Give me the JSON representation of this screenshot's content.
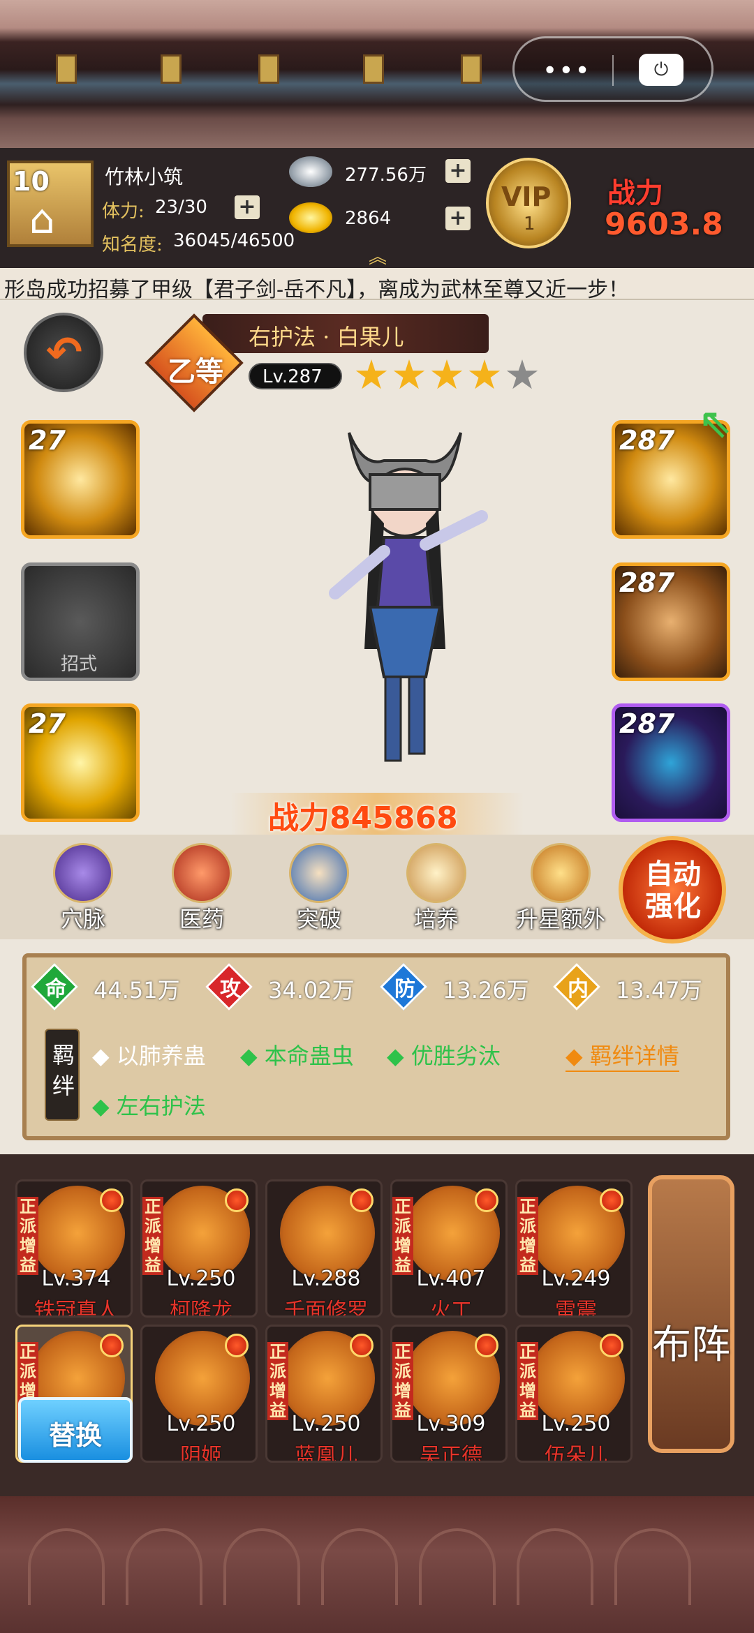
{
  "player": {
    "level": "10",
    "name": "竹林小筑",
    "stamina_label": "体力:",
    "stamina_value": "23/30",
    "fame_label": "知名度:",
    "fame_value": "36045/46500"
  },
  "resources": {
    "silver": "277.56万",
    "gold": "2864"
  },
  "vip": {
    "label": "VIP",
    "level": "1"
  },
  "top_power": {
    "label": "战力",
    "value": "9603.8"
  },
  "marquee": "形岛成功招募了甲级【君子剑-岳不凡】，离成为武林至尊又近一步！",
  "hero": {
    "title": "右护法 · 白果儿",
    "grade": "乙等",
    "level": "Lv.287",
    "stars_filled": 4,
    "stars_total": 5,
    "power": "战力845868"
  },
  "skills": [
    {
      "level": "27"
    },
    {
      "label": "招式"
    },
    {
      "level": "27"
    }
  ],
  "equipment": [
    {
      "level": "287"
    },
    {
      "level": "287"
    },
    {
      "level": "287"
    }
  ],
  "functions": [
    {
      "label": "穴脉",
      "icon": "meridian-icon"
    },
    {
      "label": "医药",
      "icon": "medicine-icon"
    },
    {
      "label": "突破",
      "icon": "breakthrough-icon"
    },
    {
      "label": "培养",
      "icon": "cultivate-icon"
    },
    {
      "label": "升星额外",
      "icon": "star-up-icon"
    }
  ],
  "auto_enhance": "自动强化",
  "attributes": [
    {
      "key": "命",
      "value": "44.51万",
      "color": "#1fa83a"
    },
    {
      "key": "攻",
      "value": "34.02万",
      "color": "#d8262a"
    },
    {
      "key": "防",
      "value": "13.26万",
      "color": "#1e78d8"
    },
    {
      "key": "内",
      "value": "13.47万",
      "color": "#e8a21a"
    }
  ],
  "bonds": {
    "tag": "羁绊",
    "items": [
      {
        "label": "以肺养蛊",
        "active": false
      },
      {
        "label": "本命蛊虫",
        "active": true
      },
      {
        "label": "优胜劣汰",
        "active": true
      },
      {
        "label": "左右护法",
        "active": true
      }
    ],
    "detail": "羁绊详情"
  },
  "roster": [
    {
      "level": "Lv.374",
      "name": "铁冠真人",
      "tag": "正派增益"
    },
    {
      "level": "Lv.250",
      "name": "柯降龙",
      "tag": "正派增益"
    },
    {
      "level": "Lv.288",
      "name": "千面修罗",
      "tag": ""
    },
    {
      "level": "Lv.407",
      "name": "火工",
      "tag": "正派增益"
    },
    {
      "level": "Lv.249",
      "name": "雷震",
      "tag": "正派增益"
    },
    {
      "level": "",
      "name": "",
      "tag": "正派增益"
    },
    {
      "level": "Lv.250",
      "name": "阴姬",
      "tag": ""
    },
    {
      "level": "Lv.250",
      "name": "蓝凰儿",
      "tag": "正派增益"
    },
    {
      "level": "Lv.309",
      "name": "吴正德",
      "tag": "正派增益"
    },
    {
      "level": "Lv.250",
      "name": "伍朵儿",
      "tag": "正派增益"
    }
  ],
  "swap_label": "替换",
  "deploy_label": "布阵",
  "colors": {
    "accent": "#f5a623",
    "danger": "#e8342a",
    "bond_active": "#2ec24a"
  }
}
